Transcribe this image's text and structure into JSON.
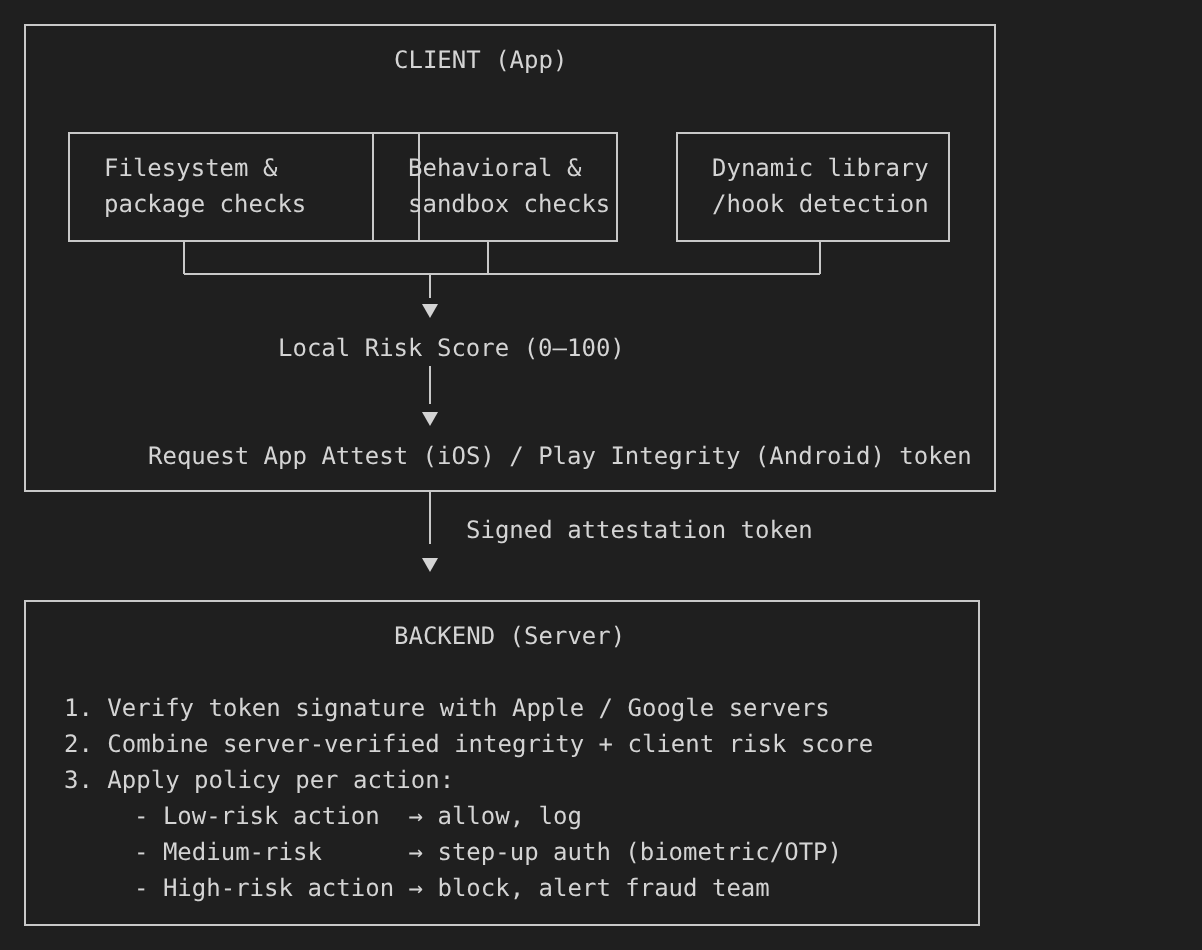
{
  "client": {
    "title": "CLIENT (App)",
    "checks": [
      {
        "lines": [
          "Filesystem &",
          "package checks"
        ]
      },
      {
        "lines": [
          "Behavioral &",
          "sandbox checks"
        ]
      },
      {
        "lines": [
          "Dynamic library",
          "/hook detection"
        ]
      }
    ],
    "score": "Local Risk Score (0–100)",
    "request": "Request App Attest (iOS) / Play Integrity (Android) token"
  },
  "transfer": {
    "label": "Signed attestation token"
  },
  "backend": {
    "title": "BACKEND (Server)",
    "steps": [
      "1. Verify token signature with Apple / Google servers",
      "2. Combine server-verified integrity + client risk score",
      "3. Apply policy per action:"
    ],
    "policies": [
      "- Low-risk action  → allow, log",
      "- Medium-risk      → step-up auth (biometric/OTP)",
      "- High-risk action → block, alert fraud team"
    ]
  }
}
